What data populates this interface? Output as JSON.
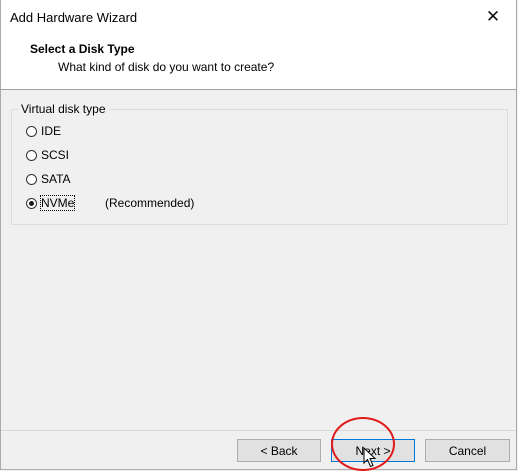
{
  "window": {
    "title": "Add Hardware Wizard",
    "close_glyph": "✕"
  },
  "header": {
    "title": "Select a Disk Type",
    "subtitle": "What kind of disk do you want to create?"
  },
  "disk_type": {
    "group_label": "Virtual disk type",
    "options": [
      {
        "label": "IDE",
        "selected": false
      },
      {
        "label": "SCSI",
        "selected": false
      },
      {
        "label": "SATA",
        "selected": false
      },
      {
        "label": "NVMe",
        "selected": true
      }
    ],
    "recommended_note": "(Recommended)"
  },
  "buttons": {
    "back": "< Back",
    "next": "Next >",
    "cancel": "Cancel"
  },
  "colors": {
    "annotation_circle": "#e21b1b",
    "default_button_border": "#0078d7"
  },
  "icons": [
    "close-icon",
    "mouse-cursor-icon"
  ]
}
